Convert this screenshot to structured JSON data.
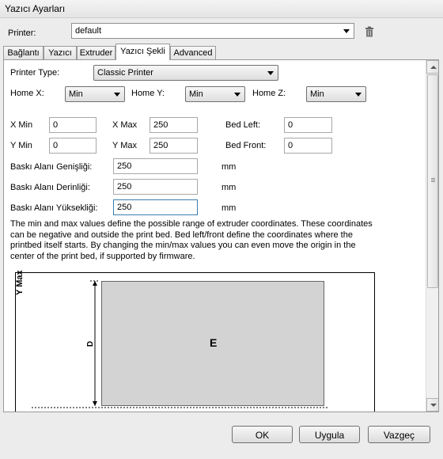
{
  "window": {
    "title": "Yazıcı Ayarları"
  },
  "printer": {
    "label": "Printer:",
    "value": "default"
  },
  "tabs": [
    {
      "label": "Bağlantı",
      "active": false
    },
    {
      "label": "Yazıcı",
      "active": false
    },
    {
      "label": "Extruder",
      "active": false
    },
    {
      "label": "Yazıcı Şekli",
      "active": true
    },
    {
      "label": "Advanced",
      "active": false
    }
  ],
  "form": {
    "printer_type_label": "Printer Type:",
    "printer_type_value": "Classic Printer",
    "home_x_label": "Home X:",
    "home_x_value": "Min",
    "home_y_label": "Home Y:",
    "home_y_value": "Min",
    "home_z_label": "Home Z:",
    "home_z_value": "Min",
    "x_min_label": "X Min",
    "x_min_value": "0",
    "x_max_label": "X Max",
    "x_max_value": "250",
    "bed_left_label": "Bed Left:",
    "bed_left_value": "0",
    "y_min_label": "Y Min",
    "y_min_value": "0",
    "y_max_label": "Y Max",
    "y_max_value": "250",
    "bed_front_label": "Bed Front:",
    "bed_front_value": "0",
    "width_label": "Baskı Alanı Genişliği:",
    "width_value": "250",
    "width_unit": "mm",
    "depth_label": "Baskı Alanı Derinliği:",
    "depth_value": "250",
    "depth_unit": "mm",
    "height_label": "Baskı Alanı Yüksekliği:",
    "height_value": "250",
    "height_unit": "mm"
  },
  "description": [
    "The min and max values define the possible range of extruder coordinates. These coordinates",
    "can be negative and outside the print bed. Bed left/front define the coordinates where the",
    "printbed itself starts. By changing the min/max values you can even move the origin in the",
    "center of the print bed, if supported by firmware."
  ],
  "diagram": {
    "y_axis_label": "Y Max",
    "depth_marker": "D",
    "bed_label": "E"
  },
  "buttons": {
    "ok": "OK",
    "apply": "Uygula",
    "cancel": "Vazgeç"
  },
  "icons": {
    "delete": "trash-icon"
  }
}
